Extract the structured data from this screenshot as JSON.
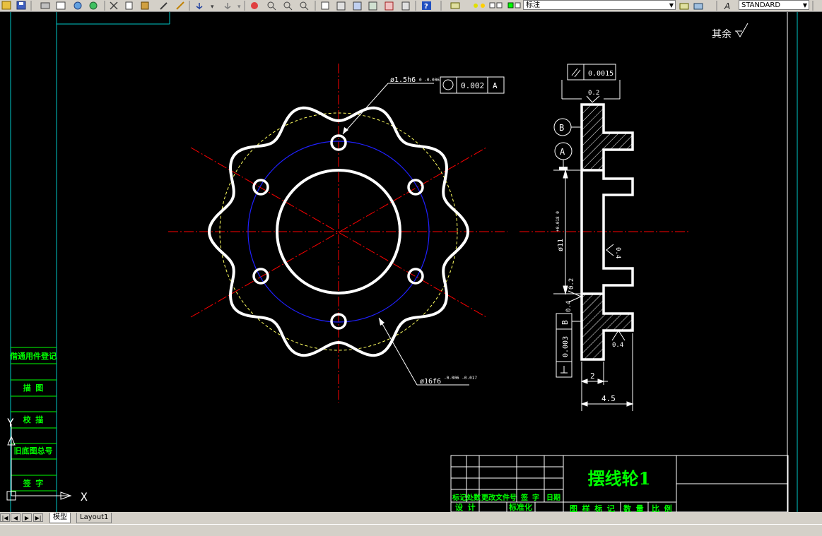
{
  "toolbar": {
    "layer_combo": "标注",
    "style_combo": "STANDARD"
  },
  "tabs": [
    {
      "label": "模型",
      "active": true
    },
    {
      "label": "Layout1",
      "active": false
    }
  ],
  "drawing": {
    "roughness_note": "其余",
    "left_labels": [
      "借通用件登记",
      "描 图",
      "校 描",
      "旧底图总号",
      "签 字"
    ],
    "ucs": {
      "x": "X",
      "y": "Y"
    },
    "front_view": {
      "hole_dim": "ø1.5h6",
      "hole_tol": "0 -0.006",
      "roundness_value": "0.002",
      "roundness_datum": "A",
      "bore_dim": "ø16f6",
      "bore_tol": "-0.006 -0.017"
    },
    "side_view": {
      "parallel_value": "0.0015",
      "datum_b": "B",
      "datum_a": "A",
      "rough_top": "0.2",
      "rough_mid": "0.4",
      "rough_left1": "0.2",
      "rough_left2": "0.4",
      "rough_bottom": "0.4",
      "dia_dim": "ø11",
      "dia_tol": "+0.018 0",
      "perp_value": "0.003",
      "perp_datum": "B",
      "width_small": "2",
      "width_total": "4.5"
    },
    "title_block": {
      "part_name": "摆线轮1",
      "row_mark": "标记处数",
      "row_doc": "更改文件号",
      "row_sign": "签 字",
      "row_date": "日期",
      "design": "设 计",
      "standard": "标准化",
      "drawing_mark": "图 样 标 记",
      "quantity": "数 量",
      "scale": "比 例"
    }
  },
  "colors": {
    "bg": "#000000",
    "green": "#00ff00",
    "cyan": "#00c8c8",
    "red": "#ff0000",
    "blue": "#2020ff",
    "yellow": "#ffff60",
    "white": "#ffffff"
  }
}
